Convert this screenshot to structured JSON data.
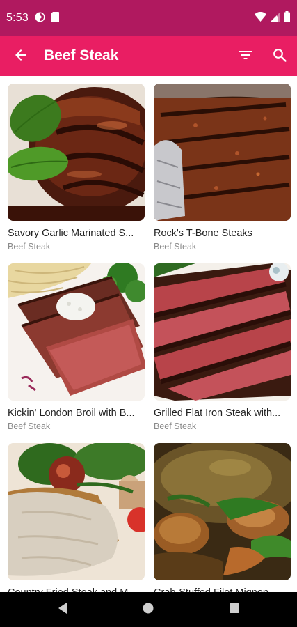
{
  "status_bar": {
    "time": "5:53",
    "left_icons": [
      "app-notification-icon",
      "sd-card-icon"
    ],
    "right_icons": [
      "wifi-icon",
      "signal-icon",
      "battery-icon"
    ]
  },
  "app_bar": {
    "title": "Beef Steak",
    "back_icon": "arrow-back-icon",
    "filter_icon": "filter-icon",
    "search_icon": "search-icon",
    "color": "#e91e63",
    "status_color": "#b0195f"
  },
  "recipes": [
    {
      "name": "Savory Garlic Marinated S...",
      "category": "Beef Steak",
      "image": "savory-garlic-steak-photo"
    },
    {
      "name": "Rock's T-Bone Steaks",
      "category": "Beef Steak",
      "image": "t-bone-steak-photo"
    },
    {
      "name": "Kickin' London Broil with B...",
      "category": "Beef Steak",
      "image": "london-broil-photo"
    },
    {
      "name": "Grilled Flat Iron Steak with...",
      "category": "Beef Steak",
      "image": "flat-iron-steak-photo"
    },
    {
      "name": "Country Fried Steak and M...",
      "category": "",
      "image": "country-fried-steak-photo"
    },
    {
      "name": "Crab-Stuffed Filet Mignon...",
      "category": "",
      "image": "filet-mignon-photo"
    }
  ],
  "nav_bar": {
    "back_icon": "nav-back-icon",
    "home_icon": "nav-home-icon",
    "recents_icon": "nav-recents-icon"
  }
}
